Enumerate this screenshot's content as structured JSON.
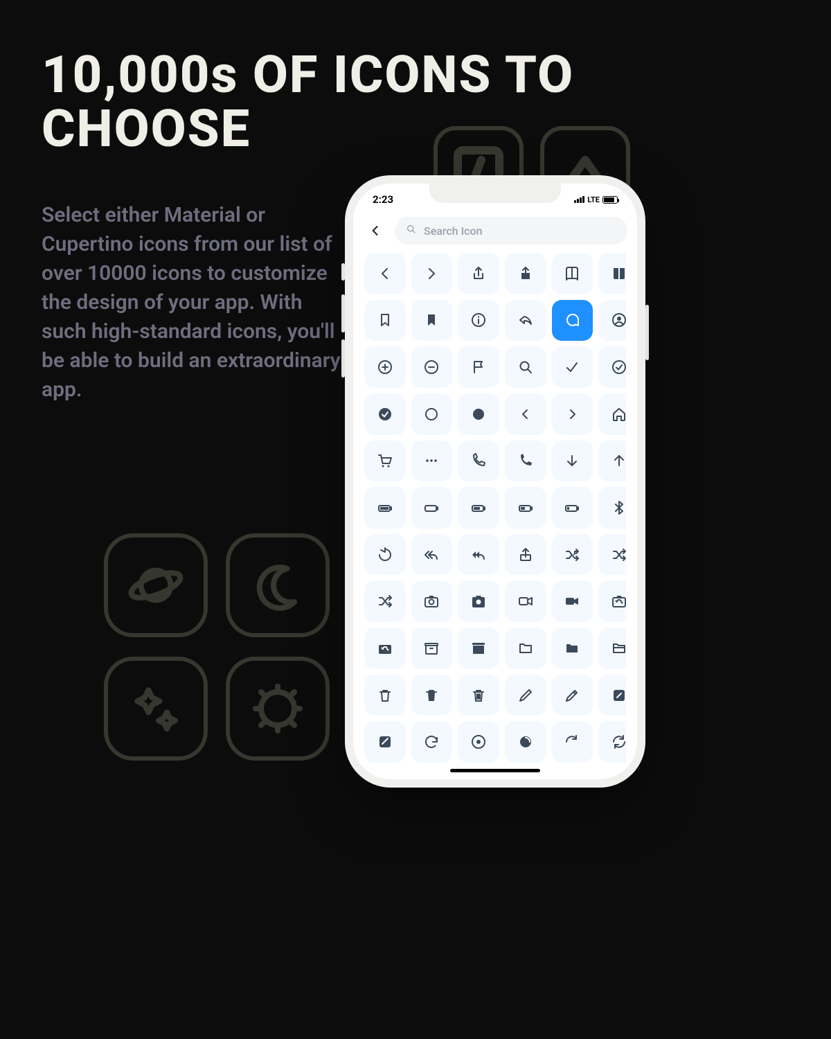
{
  "heading": "10,000s OF ICONS TO CHOOSE",
  "paragraph": "Select either Material or Cupertino icons from our list of over 10000 icons to customize the design of your app. With such high-standard icons, you'll be able to build an extraordinary app.",
  "bg_tiles": [
    "code-angle",
    "eject",
    "planet",
    "moon",
    "sparkles",
    "gear"
  ],
  "statusbar": {
    "time": "2:23",
    "network": "LTE"
  },
  "search": {
    "placeholder": "Search Icon"
  },
  "colors": {
    "accent": "#1e90ff",
    "icon_tile": "#f4f9ff",
    "icon": "#3b4a5a",
    "bg": "#0c0c0c"
  },
  "grid_selected_index": 10,
  "grid": [
    "chevron-left",
    "chevron-right",
    "share",
    "share-filled",
    "book",
    "book-filled",
    "bookmark",
    "bookmark-filled",
    "info-circle",
    "reply",
    "chat-bubble",
    "user-circle",
    "plus-circle",
    "minus-circle",
    "flag",
    "search",
    "check",
    "check-circle",
    "check-filled",
    "circle",
    "circle-filled",
    "angle-left",
    "angle-right",
    "home",
    "cart",
    "ellipsis",
    "phone-outline",
    "phone-filled",
    "arrow-down",
    "arrow-up",
    "battery-full",
    "battery-empty",
    "battery-75",
    "battery-50",
    "battery-25",
    "bluetooth",
    "refresh-ccw",
    "reply-all",
    "reply-all-filled",
    "share-up",
    "shuffle",
    "shuffle-alt",
    "shuffle-bold",
    "camera-outline",
    "camera-filled",
    "video-outline",
    "video-filled",
    "camera-rotate",
    "camera-flip",
    "archive-outline",
    "archive-filled",
    "folder-outline",
    "folder-filled",
    "folder-alt",
    "trash-outline",
    "trash-filled",
    "trash-stripes",
    "pencil",
    "pencil-alt",
    "compose",
    "note-filled",
    "rotate-cw",
    "target",
    "loading",
    "refresh-cw",
    "refresh-cw-alt"
  ]
}
